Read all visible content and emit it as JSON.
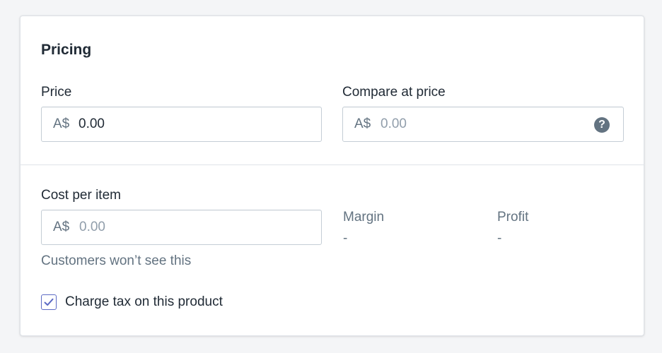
{
  "card": {
    "title": "Pricing"
  },
  "price": {
    "label": "Price",
    "prefix": "A$",
    "value": "0.00"
  },
  "compare_at_price": {
    "label": "Compare at price",
    "prefix": "A$",
    "placeholder": "0.00",
    "help_icon": "question-circle-icon",
    "help_glyph": "?"
  },
  "cost_per_item": {
    "label": "Cost per item",
    "prefix": "A$",
    "placeholder": "0.00",
    "helper_text": "Customers won’t see this"
  },
  "margin": {
    "label": "Margin",
    "value": "-"
  },
  "profit": {
    "label": "Profit",
    "value": "-"
  },
  "charge_tax": {
    "label": "Charge tax on this product",
    "checked": true
  },
  "colors": {
    "accent": "#5c6ac4",
    "text": "#212b36",
    "subdued": "#637381",
    "placeholder": "#919eab",
    "border": "#c4cdd5"
  }
}
